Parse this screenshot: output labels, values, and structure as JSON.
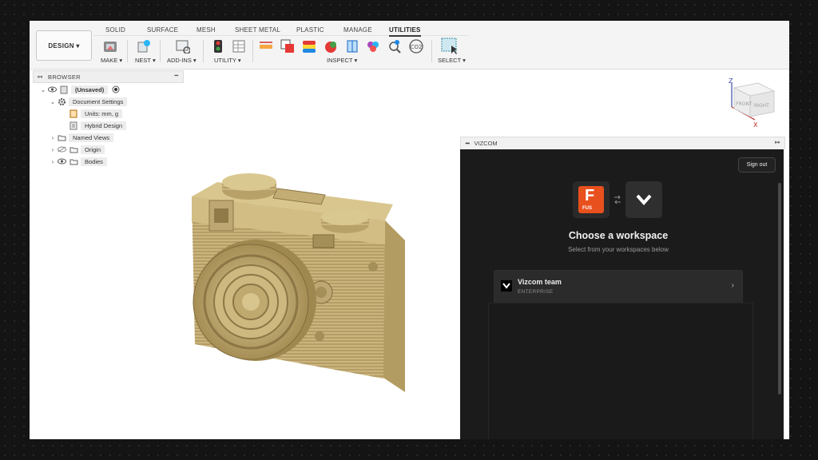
{
  "toolbar": {
    "workspace_label": "DESIGN ▾",
    "tabs": [
      "SOLID",
      "SURFACE",
      "MESH",
      "SHEET METAL",
      "PLASTIC",
      "MANAGE",
      "UTILITIES"
    ],
    "active_tab": "UTILITIES",
    "groups": [
      "MAKE ▾",
      "NEST ▾",
      "ADD-INS ▾",
      "UTILITY ▾",
      "INSPECT ▾",
      "SELECT ▾"
    ]
  },
  "browser": {
    "title": "BROWSER",
    "items": [
      {
        "label": "(Unsaved)",
        "icon": "document-icon"
      },
      {
        "label": "Document Settings",
        "icon": "gear-icon"
      },
      {
        "label": "Units: mm, g",
        "icon": "units-icon"
      },
      {
        "label": "Hybrid Design",
        "icon": "design-icon"
      },
      {
        "label": "Named Views",
        "icon": "folder-icon"
      },
      {
        "label": "Origin",
        "icon": "folder-icon"
      },
      {
        "label": "Bodies",
        "icon": "folder-icon"
      }
    ]
  },
  "viewcube": {
    "front": "FRONT",
    "right": "RIGHT",
    "z": "Z",
    "x": "X"
  },
  "vizcom": {
    "panel_title": "VIZCOM",
    "sign_out": "Sign out",
    "fusion_logo_letter": "F",
    "fusion_logo_text": "FUS",
    "title": "Choose a workspace",
    "subtitle": "Select from your workspaces below",
    "workspace": {
      "name": "Vizcom team",
      "tier": "ENTERPRISE"
    }
  },
  "colors": {
    "fusion_orange": "#e8501e",
    "panel_bg": "#1b1b1b",
    "card_bg": "#2b2b2b",
    "camera_body": "#c9b47c"
  }
}
